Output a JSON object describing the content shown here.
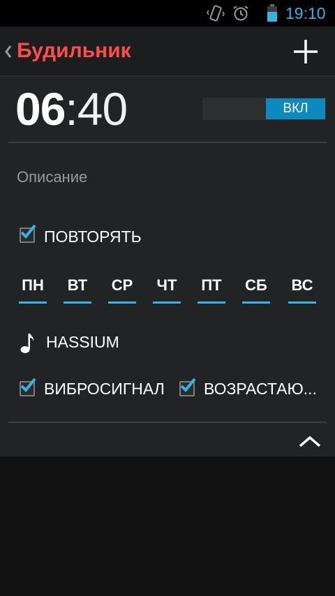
{
  "status_bar": {
    "time": "19:10",
    "icons": [
      "vibrate-icon",
      "alarm-clock-icon",
      "battery-icon"
    ],
    "accent_color": "#33b5e5"
  },
  "action_bar": {
    "title": "Будильник",
    "title_color": "#ff4c4c",
    "icons": [
      "chevron-left-icon",
      "plus-icon"
    ]
  },
  "alarm": {
    "hours": "06",
    "separator": ":",
    "minutes": "40",
    "toggle_label": "ВКЛ",
    "toggle_on": true,
    "description_placeholder": "Описание",
    "repeat_label": "ПОВТОРЯТЬ",
    "repeat_checked": true,
    "days": [
      {
        "label": "ПН",
        "selected": true
      },
      {
        "label": "ВТ",
        "selected": true
      },
      {
        "label": "СР",
        "selected": true
      },
      {
        "label": "ЧТ",
        "selected": true
      },
      {
        "label": "ПТ",
        "selected": true
      },
      {
        "label": "СБ",
        "selected": true
      },
      {
        "label": "ВС",
        "selected": true
      }
    ],
    "ringtone": "HASSIUM",
    "vibrate_label": "ВИБРОСИГНАЛ",
    "vibrate_checked": true,
    "increasing_label": "ВОЗРАСТАЮ...",
    "increasing_checked": true,
    "collapse_icon": "chevron-up-icon"
  },
  "colors": {
    "accent": "#33b5e5",
    "toggle_on": "#0c8ac0"
  }
}
